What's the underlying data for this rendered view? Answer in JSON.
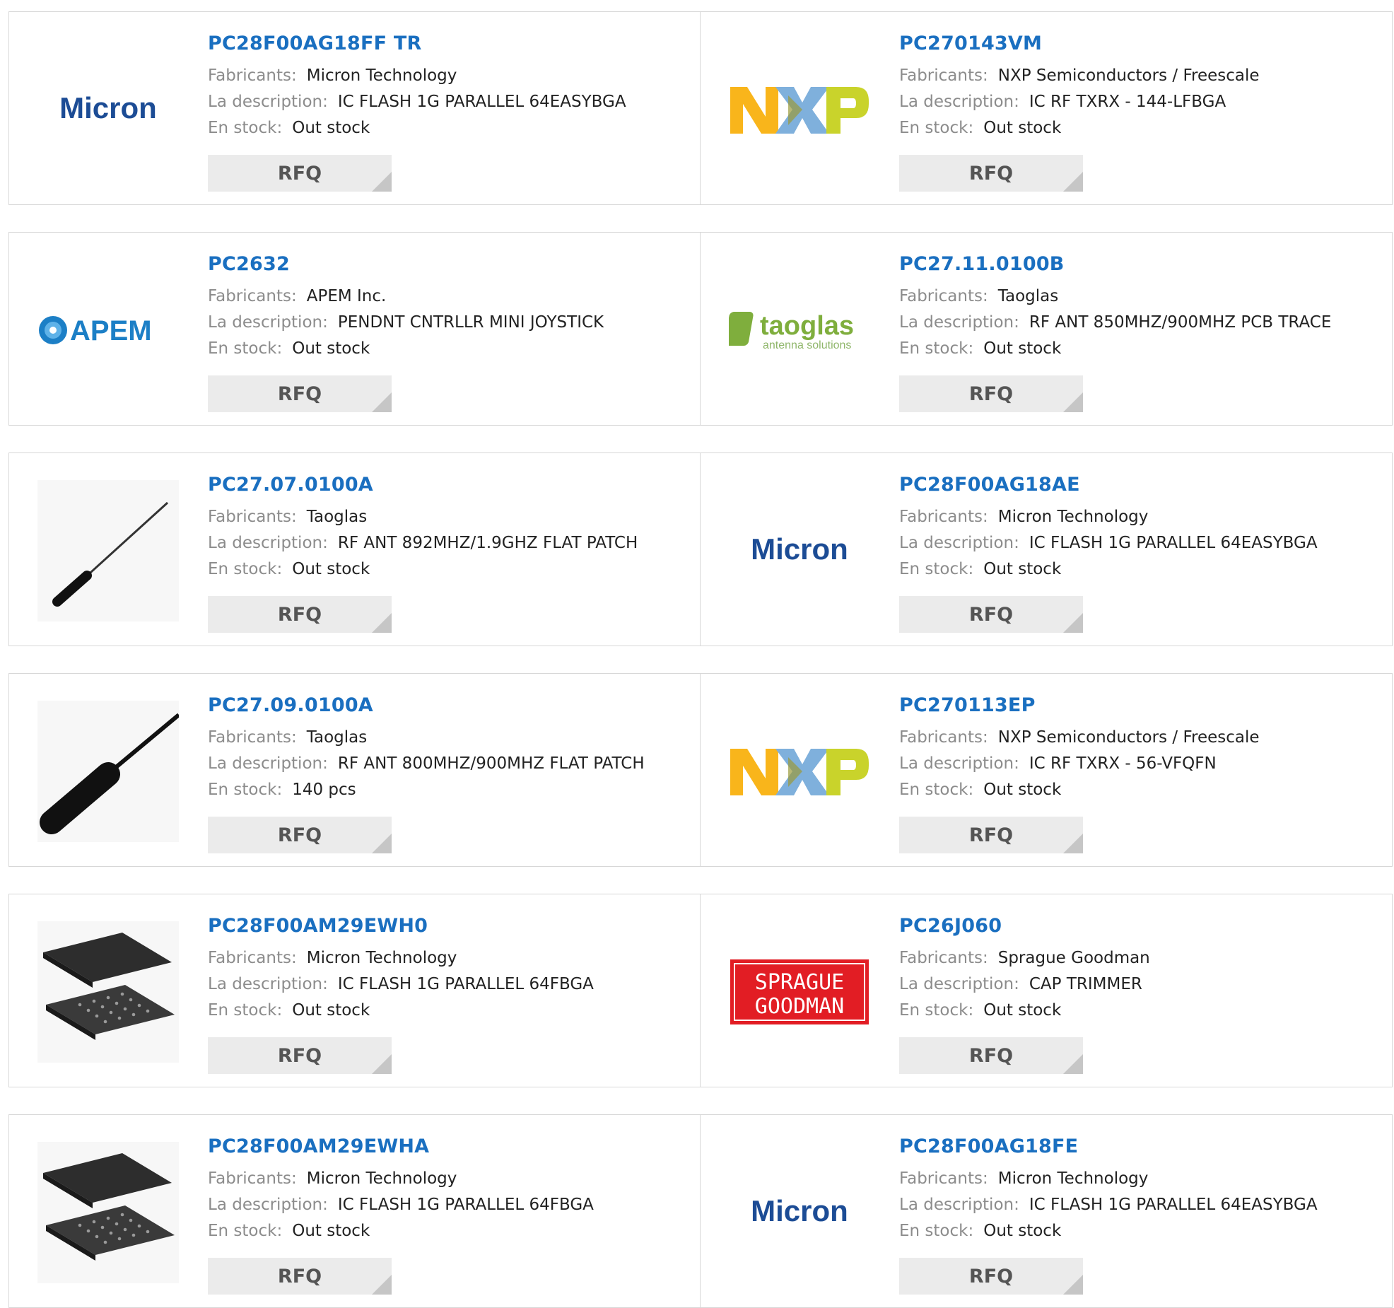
{
  "labels": {
    "manufacturer": "Fabricants:",
    "description": "La description:",
    "stock": "En stock:",
    "rfq": "RFQ"
  },
  "products": [
    {
      "part": "PC28F00AG18FF TR",
      "manufacturer": "Micron Technology",
      "description": "IC FLASH 1G PARALLEL 64EASYBGA",
      "stock": "Out stock",
      "image": "micron-logo"
    },
    {
      "part": "PC270143VM",
      "manufacturer": "NXP Semiconductors / Freescale",
      "description": "IC RF TXRX - 144-LFBGA",
      "stock": "Out stock",
      "image": "nxp-logo"
    },
    {
      "part": "PC2632",
      "manufacturer": "APEM Inc.",
      "description": "PENDNT CNTRLLR MINI JOYSTICK",
      "stock": "Out stock",
      "image": "apem-logo"
    },
    {
      "part": "PC27.11.0100B",
      "manufacturer": "Taoglas",
      "description": "RF ANT 850MHZ/900MHZ PCB TRACE",
      "stock": "Out stock",
      "image": "taoglas-logo"
    },
    {
      "part": "PC27.07.0100A",
      "manufacturer": "Taoglas",
      "description": "RF ANT 892MHZ/1.9GHZ FLAT PATCH",
      "stock": "Out stock",
      "image": "antenna-photo"
    },
    {
      "part": "PC28F00AG18AE",
      "manufacturer": "Micron Technology",
      "description": "IC FLASH 1G PARALLEL 64EASYBGA",
      "stock": "Out stock",
      "image": "micron-logo"
    },
    {
      "part": "PC27.09.0100A",
      "manufacturer": "Taoglas",
      "description": "RF ANT 800MHZ/900MHZ FLAT PATCH",
      "stock": "140 pcs",
      "image": "antenna-photo-2"
    },
    {
      "part": "PC270113EP",
      "manufacturer": "NXP Semiconductors / Freescale",
      "description": "IC RF TXRX - 56-VFQFN",
      "stock": "Out stock",
      "image": "nxp-logo"
    },
    {
      "part": "PC28F00AM29EWH0",
      "manufacturer": "Micron Technology",
      "description": "IC FLASH 1G PARALLEL 64FBGA",
      "stock": "Out stock",
      "image": "bga-chip-photo"
    },
    {
      "part": "PC26J060",
      "manufacturer": "Sprague Goodman",
      "description": "CAP TRIMMER",
      "stock": "Out stock",
      "image": "sprague-goodman-logo"
    },
    {
      "part": "PC28F00AM29EWHA",
      "manufacturer": "Micron Technology",
      "description": "IC FLASH 1G PARALLEL 64FBGA",
      "stock": "Out stock",
      "image": "bga-chip-photo"
    },
    {
      "part": "PC28F00AG18FE",
      "manufacturer": "Micron Technology",
      "description": "IC FLASH 1G PARALLEL 64EASYBGA",
      "stock": "Out stock",
      "image": "micron-logo"
    }
  ],
  "logos": {
    "micron": "Micron",
    "apem": "APEM",
    "taoglas_name": "taoglas",
    "taoglas_tagline": "antenna solutions",
    "sprague_line1": "SPRAGUE",
    "sprague_line2": "GOODMAN"
  },
  "colors": {
    "link": "#1a6fc0",
    "label": "#8c8c8c",
    "button_bg": "#ebebeb",
    "border": "#d7d7d7"
  }
}
